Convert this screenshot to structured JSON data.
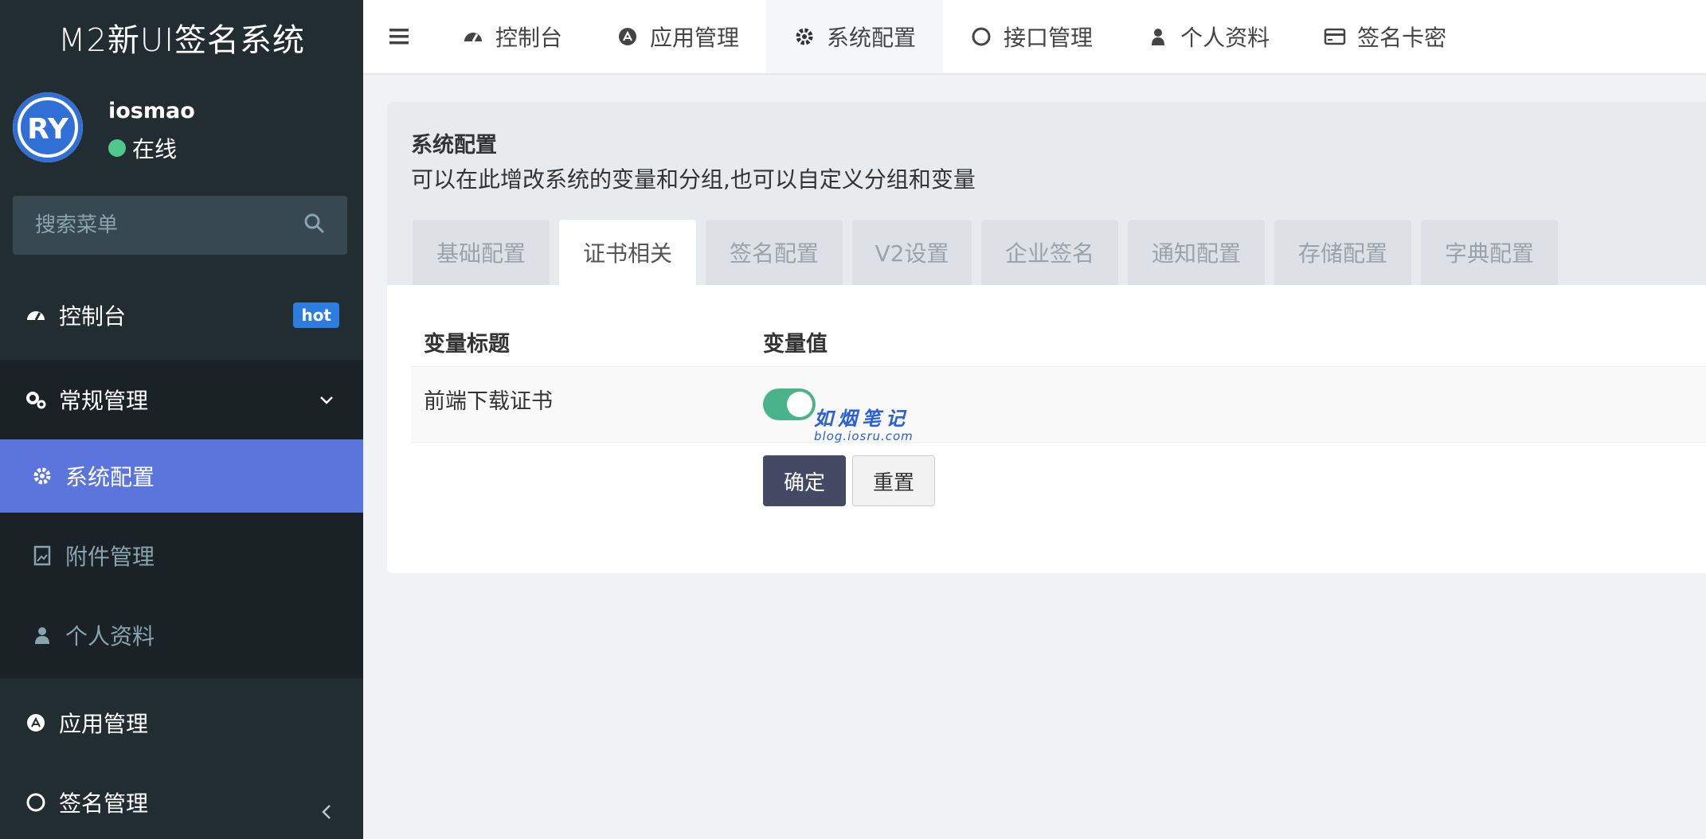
{
  "sidebar": {
    "brand": "M2新UI签名系统",
    "user": {
      "name": "iosmao",
      "status": "在线"
    },
    "search": {
      "placeholder": "搜索菜单"
    },
    "menu": {
      "dashboard": {
        "label": "控制台",
        "badge": "hot",
        "icon": "dashboard-icon"
      },
      "general": {
        "label": "常规管理",
        "icon": "cogs-icon"
      },
      "sysconf": {
        "label": "系统配置",
        "icon": "gear-icon"
      },
      "attachments": {
        "label": "附件管理",
        "icon": "image-file-icon"
      },
      "profile": {
        "label": "个人资料",
        "icon": "user-icon"
      },
      "apps": {
        "label": "应用管理",
        "icon": "app-store-icon"
      },
      "sign": {
        "label": "签名管理",
        "icon": "circle-icon"
      }
    }
  },
  "topnav": {
    "tabs": [
      {
        "label": "控制台",
        "icon": "dashboard-icon"
      },
      {
        "label": "应用管理",
        "icon": "app-store-icon"
      },
      {
        "label": "系统配置",
        "icon": "gear-icon"
      },
      {
        "label": "接口管理",
        "icon": "circle-icon"
      },
      {
        "label": "个人资料",
        "icon": "user-icon"
      },
      {
        "label": "签名卡密",
        "icon": "credit-card-icon"
      }
    ],
    "active": "系统配置"
  },
  "panel": {
    "title": "系统配置",
    "description": "可以在此增改系统的变量和分组,也可以自定义分组和变量",
    "tabs": [
      "基础配置",
      "证书相关",
      "签名配置",
      "V2设置",
      "企业签名",
      "通知配置",
      "存储配置",
      "字典配置"
    ],
    "active_tab": "证书相关",
    "table": {
      "headers": [
        "变量标题",
        "变量值"
      ],
      "rows": [
        {
          "title": "前端下载证书",
          "value": true
        }
      ]
    },
    "watermark": {
      "main": "如烟笔记",
      "sub": "blog.iosru.com"
    },
    "buttons": {
      "ok": "确定",
      "reset": "重置"
    }
  },
  "colors": {
    "sidebar_bg": "#222d32",
    "active_menu": "#5b75dc",
    "toggle_on": "#4bb38b",
    "primary_button": "#444a64",
    "hot_badge": "#2d7de0"
  }
}
